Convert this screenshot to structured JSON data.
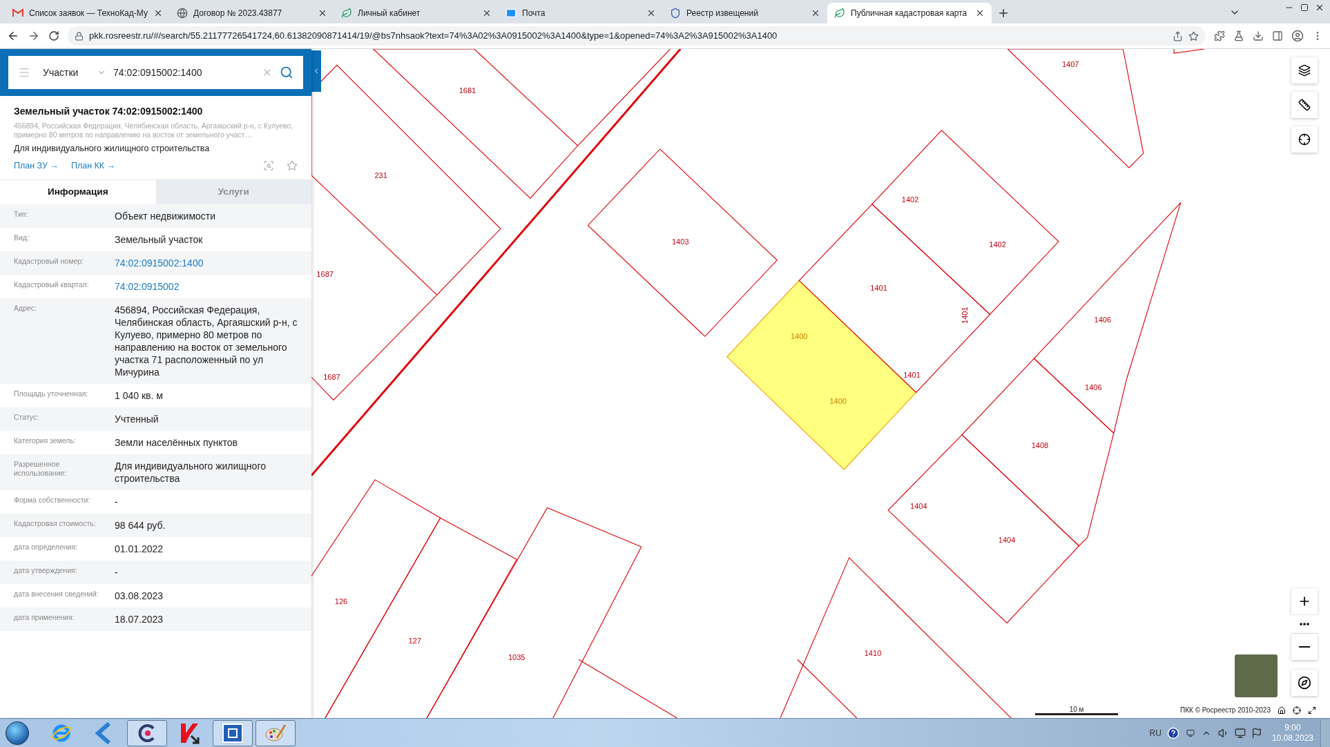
{
  "browser": {
    "tabs": [
      {
        "title": "Список заявок — ТехноКад-Му",
        "selected": false
      },
      {
        "title": "Договор № 2023.43877",
        "selected": false
      },
      {
        "title": "Личный кабинет",
        "selected": false
      },
      {
        "title": "Почта",
        "selected": false
      },
      {
        "title": "Реестр извещений",
        "selected": false
      },
      {
        "title": "Публичная кадастровая карта",
        "selected": true
      }
    ],
    "url": "pkk.rosreestr.ru/#/search/55.21177726541724,60.61382090871414/19/@bs7nhsaok?text=74%3A02%3A0915002%3A1400&type=1&opened=74%3A2%3A915002%3A1400"
  },
  "panel": {
    "search": {
      "category": "Участки",
      "value": "74:02:0915002:1400"
    },
    "object": {
      "title": "Земельный участок 74:02:0915002:1400",
      "address": "456894, Российская Федерация, Челябинская область, Аргаяшский р-н, с Кулуево, примерно 80 метров по направлению на восток от земельного участ…",
      "purpose": "Для индивидуального жилищного строительства",
      "links": [
        "План ЗУ →",
        "План КК →"
      ]
    },
    "tabs": [
      {
        "label": "Информация",
        "selected": true
      },
      {
        "label": "Услуги",
        "selected": false
      }
    ],
    "rows": [
      {
        "label": "Тип:",
        "value": "Объект недвижимости",
        "link": false
      },
      {
        "label": "Вид:",
        "value": "Земельный участок",
        "link": false
      },
      {
        "label": "Кадастровый номер:",
        "value": "74:02:0915002:1400",
        "link": true
      },
      {
        "label": "Кадастровый квартал:",
        "value": "74:02:0915002",
        "link": true
      },
      {
        "label": "Адрес:",
        "value": "456894, Российская Федерация, Челябинская область, Аргаяшский р-н, с Кулуево, примерно 80 метров по направлению на восток от земельного участка 71 расположенный по ул Мичурина",
        "link": false
      },
      {
        "label": "Площадь уточненная:",
        "value": "1 040 кв. м",
        "link": false
      },
      {
        "label": "Статус:",
        "value": "Учтенный",
        "link": false
      },
      {
        "label": "Категория земель:",
        "value": "Земли населённых пунктов",
        "link": false
      },
      {
        "label": "Разрешенное использование:",
        "value": "Для индивидуального жилищного строительства",
        "link": false
      },
      {
        "label": "Форма собственности:",
        "value": "-",
        "link": false
      },
      {
        "label": "Кадастровая стоимость:",
        "value": "98 644 руб.",
        "link": false
      },
      {
        "label": "дата определения:",
        "value": "01.01.2022",
        "link": false
      },
      {
        "label": "дата утверждения:",
        "value": "-",
        "link": false
      },
      {
        "label": "дата внесения сведений:",
        "value": "03.08.2023",
        "link": false
      },
      {
        "label": "дата применения:",
        "value": "18.07.2023",
        "link": false
      }
    ]
  },
  "map": {
    "parcels": [
      {
        "labels": [
          "1681"
        ],
        "selected": false
      },
      {
        "labels": [
          "231"
        ],
        "selected": false
      },
      {
        "labels": [
          "1687",
          "1687"
        ],
        "selected": false
      },
      {
        "labels": [
          "1403"
        ],
        "selected": false
      },
      {
        "labels": [
          "1400",
          "1400"
        ],
        "selected": true
      },
      {
        "labels": [
          "1401",
          "1401",
          "1401"
        ],
        "selected": false
      },
      {
        "labels": [
          "1402",
          "1402"
        ],
        "selected": false
      },
      {
        "labels": [
          "1407"
        ],
        "selected": false
      },
      {
        "labels": [
          "1406",
          "1406"
        ],
        "selected": false
      },
      {
        "labels": [
          "1408"
        ],
        "selected": false
      },
      {
        "labels": [
          "1404",
          "1404"
        ],
        "selected": false
      },
      {
        "labels": [
          "126"
        ],
        "selected": false
      },
      {
        "labels": [
          "127"
        ],
        "selected": false
      },
      {
        "labels": [
          "1035"
        ],
        "selected": false
      },
      {
        "labels": [
          "1410"
        ],
        "selected": false
      }
    ],
    "scale": "10 м",
    "attribution": "ПКК © Росреестр 2010-2023"
  },
  "taskbar": {
    "apps": [
      {
        "running": false
      },
      {
        "running": false
      },
      {
        "running": true
      },
      {
        "running": false
      },
      {
        "running": true
      },
      {
        "running": true
      }
    ],
    "language": "RU",
    "time": "9:00",
    "date": "10.08.2023"
  }
}
